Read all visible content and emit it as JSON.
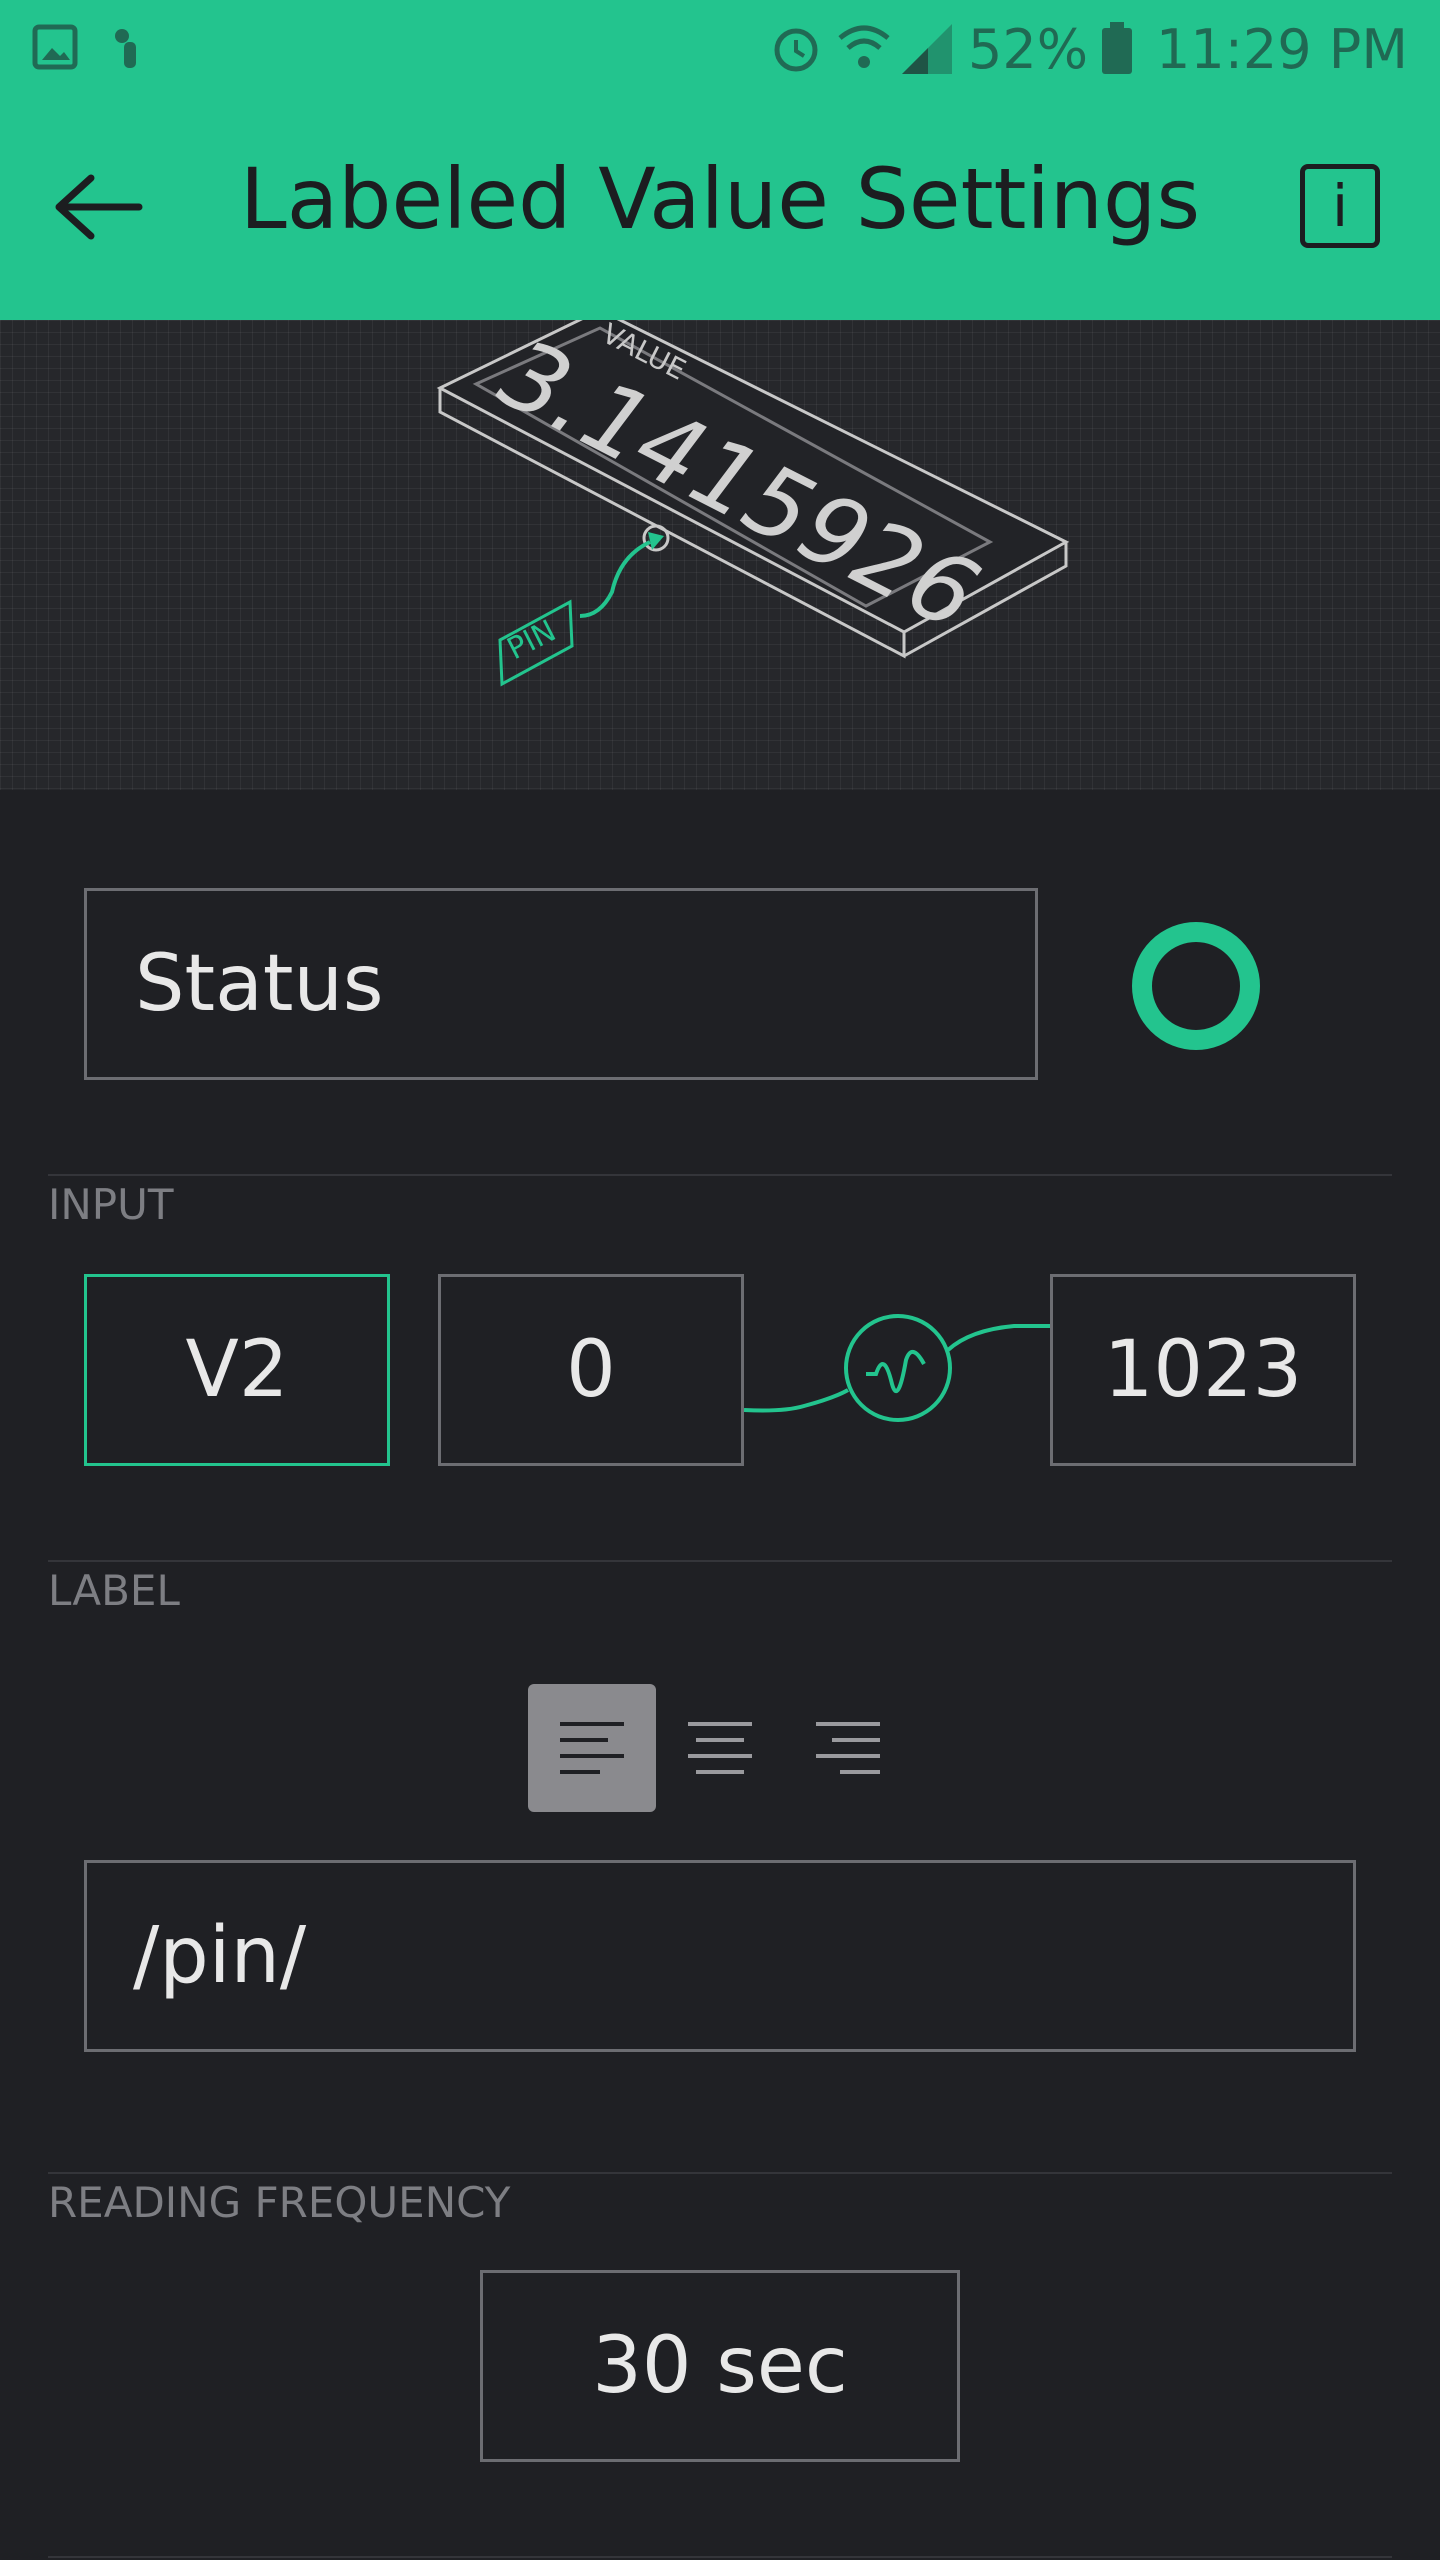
{
  "status_bar": {
    "battery": "52%",
    "time": "11:29 PM"
  },
  "header": {
    "title": "Labeled Value Settings",
    "info_label": "i"
  },
  "preview": {
    "value_caption": "VALUE",
    "value_number": "3.1415926",
    "pin_label": "PIN"
  },
  "name_field": {
    "value": "Status"
  },
  "input": {
    "section_label": "INPUT",
    "pin": "V2",
    "min": "0",
    "max": "1023"
  },
  "label": {
    "section_label": "LABEL",
    "alignment": "left",
    "value": "/pin/"
  },
  "reading_frequency": {
    "section_label": "READING FREQUENCY",
    "value": "30 sec"
  },
  "colors": {
    "accent": "#23c48e",
    "background": "#1f2024",
    "border": "#6c6d72"
  }
}
